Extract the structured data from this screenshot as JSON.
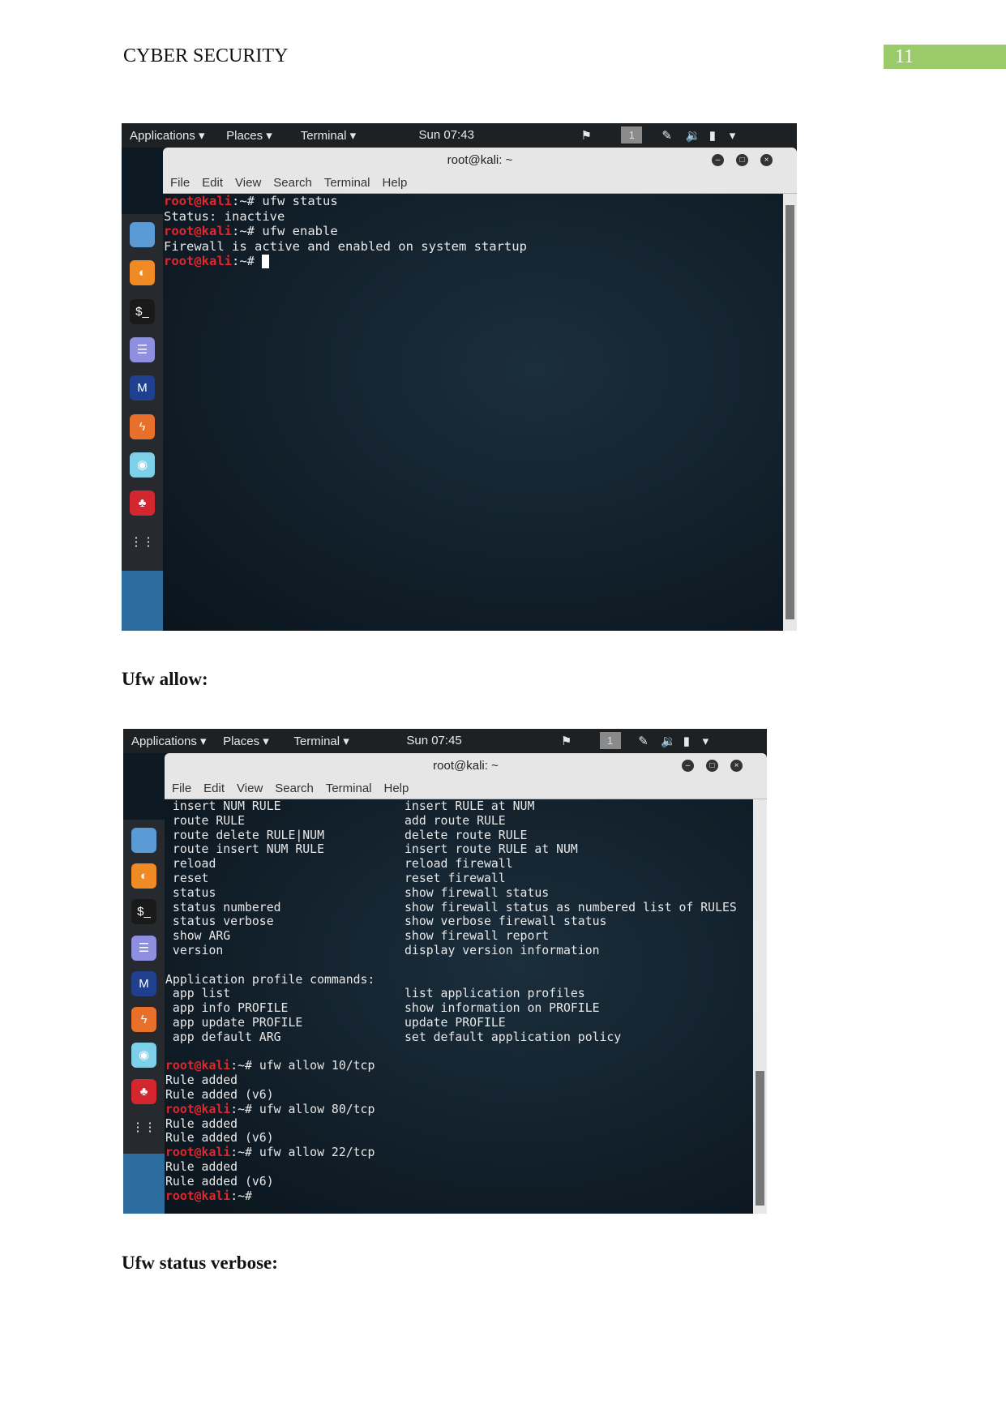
{
  "header": {
    "title": "CYBER SECURITY",
    "page_number": "11"
  },
  "topbar": {
    "applications": "Applications ▾",
    "places": "Places ▾",
    "terminal": "Terminal ▾",
    "workspace": "1"
  },
  "shot1": {
    "clock": "Sun 07:43",
    "window_title": "root@kali: ~",
    "menu": [
      "File",
      "Edit",
      "View",
      "Search",
      "Terminal",
      "Help"
    ],
    "lines": [
      {
        "prompt": "root@kali",
        "text": ":~# ufw status"
      },
      {
        "prompt": "",
        "text": "Status: inactive"
      },
      {
        "prompt": "root@kali",
        "text": ":~# ufw enable"
      },
      {
        "prompt": "",
        "text": "Firewall is active and enabled on system startup"
      },
      {
        "prompt": "root@kali",
        "text": ":~# "
      }
    ]
  },
  "heading_allow": "Ufw allow:",
  "shot2": {
    "clock": "Sun 07:45",
    "window_title": "root@kali: ~",
    "menu": [
      "File",
      "Edit",
      "View",
      "Search",
      "Terminal",
      "Help"
    ],
    "commands": [
      [
        " insert NUM RULE",
        "insert RULE at NUM"
      ],
      [
        " route RULE",
        "add route RULE"
      ],
      [
        " route delete RULE|NUM",
        "delete route RULE"
      ],
      [
        " route insert NUM RULE",
        "insert route RULE at NUM"
      ],
      [
        " reload",
        "reload firewall"
      ],
      [
        " reset",
        "reset firewall"
      ],
      [
        " status",
        "show firewall status"
      ],
      [
        " status numbered",
        "show firewall status as numbered list of RULES"
      ],
      [
        " status verbose",
        "show verbose firewall status"
      ],
      [
        " show ARG",
        "show firewall report"
      ],
      [
        " version",
        "display version information"
      ],
      [
        "",
        ""
      ],
      [
        "Application profile commands:",
        ""
      ],
      [
        " app list",
        "list application profiles"
      ],
      [
        " app info PROFILE",
        "show information on PROFILE"
      ],
      [
        " app update PROFILE",
        "update PROFILE"
      ],
      [
        " app default ARG",
        "set default application policy"
      ],
      [
        "",
        ""
      ]
    ],
    "lines": [
      {
        "prompt": "root@kali",
        "text": ":~# ufw allow 10/tcp"
      },
      {
        "prompt": "",
        "text": "Rule added"
      },
      {
        "prompt": "",
        "text": "Rule added (v6)"
      },
      {
        "prompt": "root@kali",
        "text": ":~# ufw allow 80/tcp"
      },
      {
        "prompt": "",
        "text": "Rule added"
      },
      {
        "prompt": "",
        "text": "Rule added (v6)"
      },
      {
        "prompt": "root@kali",
        "text": ":~# ufw allow 22/tcp"
      },
      {
        "prompt": "",
        "text": "Rule added"
      },
      {
        "prompt": "",
        "text": "Rule added (v6)"
      },
      {
        "prompt": "root@kali",
        "text": ":~#"
      }
    ]
  },
  "heading_verbose": "Ufw status verbose:",
  "colors": {
    "prompt": "#e2262e",
    "accent_green": "#9bca6a",
    "terminal_bg": "#0d1a24"
  },
  "dock_icons": [
    "files-icon",
    "firefox-icon",
    "terminal-icon",
    "text-editor-icon",
    "metasploit-icon",
    "burpsuite-icon",
    "eye-icon",
    "cherrytree-icon",
    "app-grid-icon"
  ]
}
